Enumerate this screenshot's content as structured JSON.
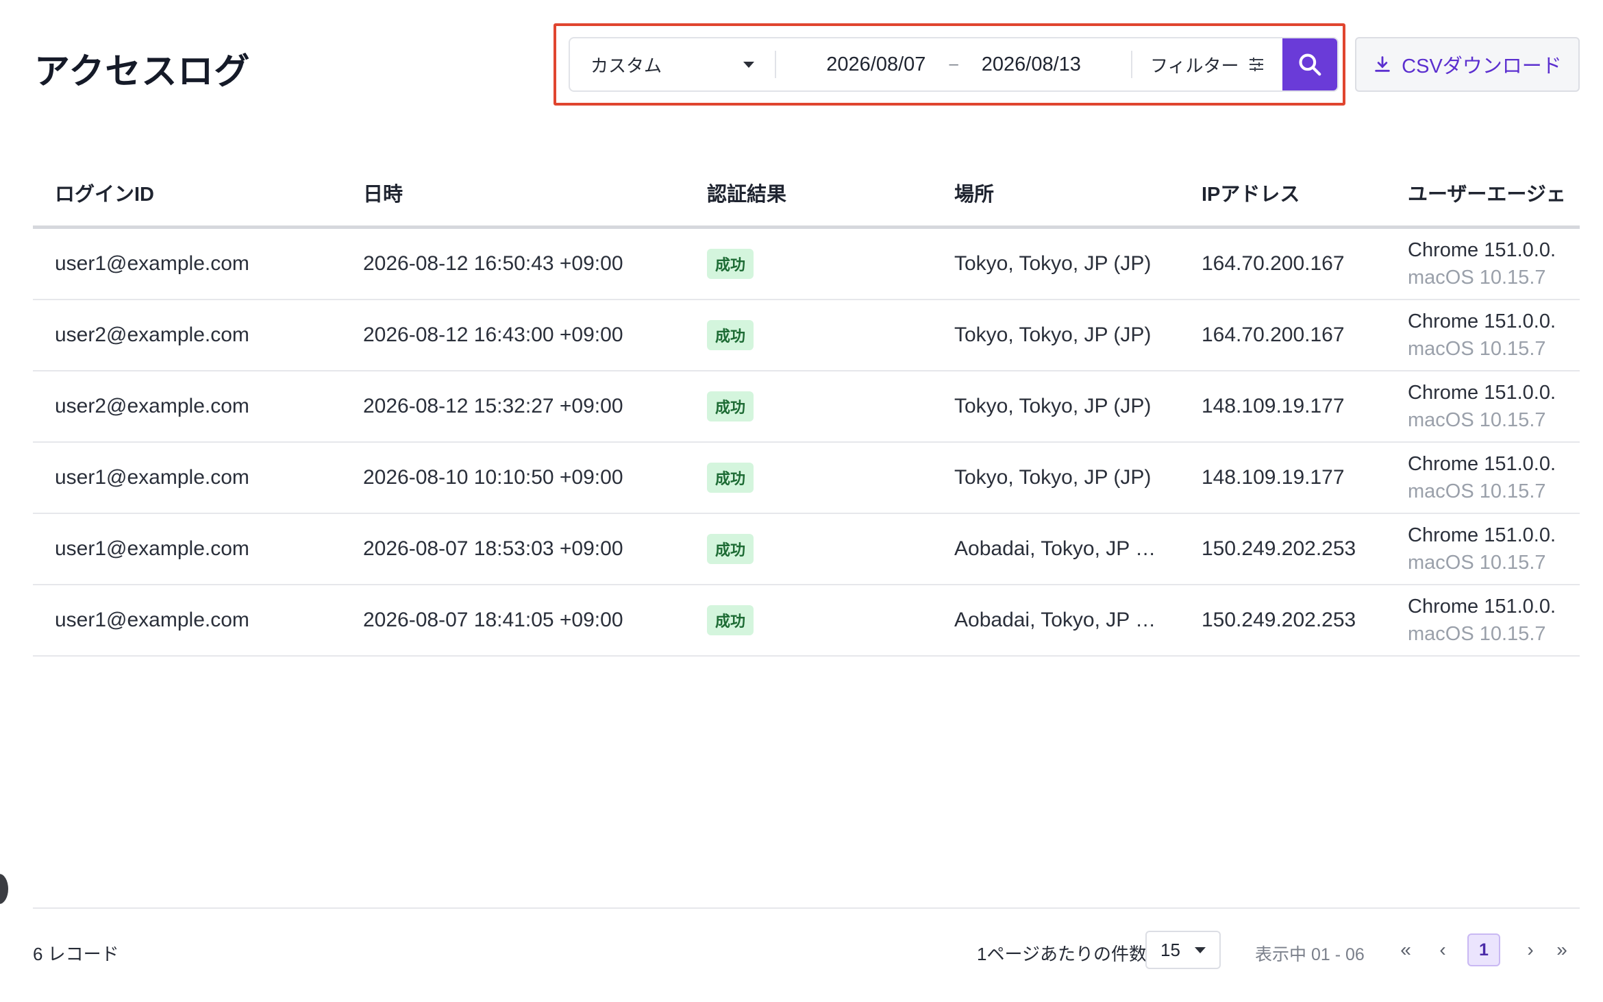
{
  "header": {
    "title": "アクセスログ"
  },
  "toolbar": {
    "period_value": "カスタム",
    "date_from": "2026/08/07",
    "date_separator": "–",
    "date_to": "2026/08/13",
    "filter_label": "フィルター",
    "csv_label": "CSVダウンロード"
  },
  "table": {
    "columns": [
      "ログインID",
      "日時",
      "認証結果",
      "場所",
      "IPアドレス",
      "ユーザーエージェ"
    ],
    "rows": [
      {
        "login_id": "user1@example.com",
        "datetime": "2026-08-12 16:50:43 +09:00",
        "result": "成功",
        "location": "Tokyo, Tokyo, JP (JP)",
        "ip": "164.70.200.167",
        "ua_browser": "Chrome 151.0.0.",
        "ua_os": "macOS 10.15.7"
      },
      {
        "login_id": "user2@example.com",
        "datetime": "2026-08-12 16:43:00 +09:00",
        "result": "成功",
        "location": "Tokyo, Tokyo, JP (JP)",
        "ip": "164.70.200.167",
        "ua_browser": "Chrome 151.0.0.",
        "ua_os": "macOS 10.15.7"
      },
      {
        "login_id": "user2@example.com",
        "datetime": "2026-08-12 15:32:27 +09:00",
        "result": "成功",
        "location": "Tokyo, Tokyo, JP (JP)",
        "ip": "148.109.19.177",
        "ua_browser": "Chrome 151.0.0.",
        "ua_os": "macOS 10.15.7"
      },
      {
        "login_id": "user1@example.com",
        "datetime": "2026-08-10 10:10:50 +09:00",
        "result": "成功",
        "location": "Tokyo, Tokyo, JP (JP)",
        "ip": "148.109.19.177",
        "ua_browser": "Chrome 151.0.0.",
        "ua_os": "macOS 10.15.7"
      },
      {
        "login_id": "user1@example.com",
        "datetime": "2026-08-07 18:53:03 +09:00",
        "result": "成功",
        "location": "Aobadai, Tokyo, JP …",
        "ip": "150.249.202.253",
        "ua_browser": "Chrome 151.0.0.",
        "ua_os": "macOS 10.15.7"
      },
      {
        "login_id": "user1@example.com",
        "datetime": "2026-08-07 18:41:05 +09:00",
        "result": "成功",
        "location": "Aobadai, Tokyo, JP …",
        "ip": "150.249.202.253",
        "ua_browser": "Chrome 151.0.0.",
        "ua_os": "macOS 10.15.7"
      }
    ]
  },
  "footer": {
    "record_count": "6 レコード",
    "per_page_label": "1ページあたりの件数",
    "per_page_value": "15",
    "showing": "表示中 01 - 06",
    "current_page": "1",
    "first_page": "«",
    "prev_page": "‹",
    "next_page": "›",
    "last_page": "»"
  },
  "colors": {
    "accent": "#6a3bd8",
    "highlight": "#e0452f",
    "success_bg": "#d4f5dd",
    "success_text": "#1d6b34"
  }
}
